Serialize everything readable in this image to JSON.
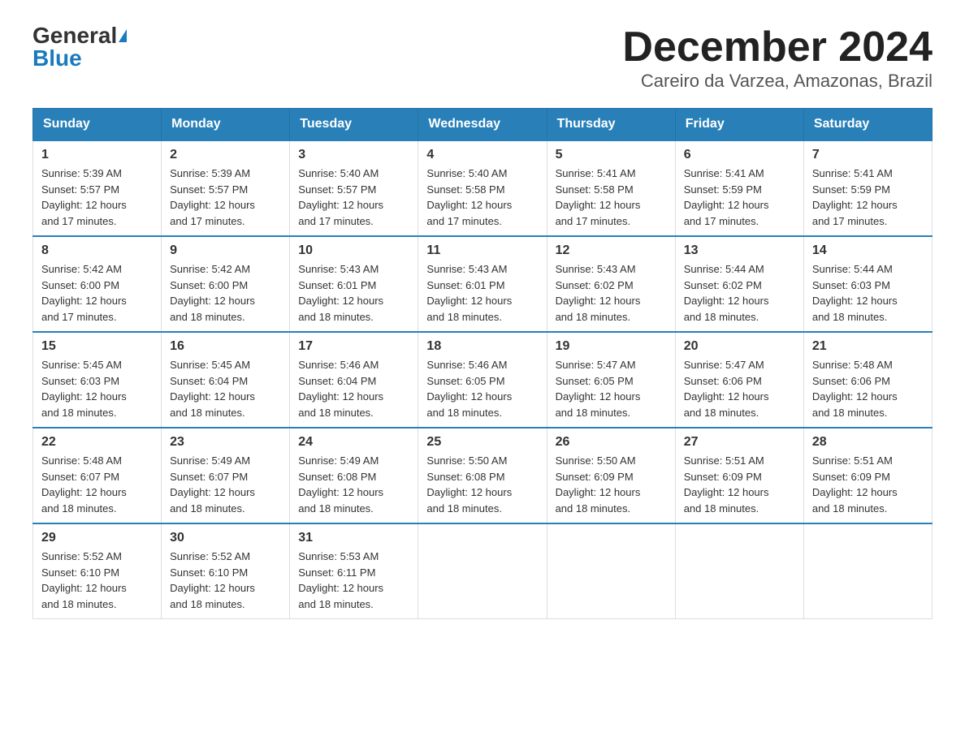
{
  "logo": {
    "general": "General",
    "blue": "Blue"
  },
  "title": "December 2024",
  "subtitle": "Careiro da Varzea, Amazonas, Brazil",
  "weekdays": [
    "Sunday",
    "Monday",
    "Tuesday",
    "Wednesday",
    "Thursday",
    "Friday",
    "Saturday"
  ],
  "weeks": [
    [
      {
        "day": "1",
        "sunrise": "5:39 AM",
        "sunset": "5:57 PM",
        "daylight": "12 hours and 17 minutes."
      },
      {
        "day": "2",
        "sunrise": "5:39 AM",
        "sunset": "5:57 PM",
        "daylight": "12 hours and 17 minutes."
      },
      {
        "day": "3",
        "sunrise": "5:40 AM",
        "sunset": "5:57 PM",
        "daylight": "12 hours and 17 minutes."
      },
      {
        "day": "4",
        "sunrise": "5:40 AM",
        "sunset": "5:58 PM",
        "daylight": "12 hours and 17 minutes."
      },
      {
        "day": "5",
        "sunrise": "5:41 AM",
        "sunset": "5:58 PM",
        "daylight": "12 hours and 17 minutes."
      },
      {
        "day": "6",
        "sunrise": "5:41 AM",
        "sunset": "5:59 PM",
        "daylight": "12 hours and 17 minutes."
      },
      {
        "day": "7",
        "sunrise": "5:41 AM",
        "sunset": "5:59 PM",
        "daylight": "12 hours and 17 minutes."
      }
    ],
    [
      {
        "day": "8",
        "sunrise": "5:42 AM",
        "sunset": "6:00 PM",
        "daylight": "12 hours and 17 minutes."
      },
      {
        "day": "9",
        "sunrise": "5:42 AM",
        "sunset": "6:00 PM",
        "daylight": "12 hours and 18 minutes."
      },
      {
        "day": "10",
        "sunrise": "5:43 AM",
        "sunset": "6:01 PM",
        "daylight": "12 hours and 18 minutes."
      },
      {
        "day": "11",
        "sunrise": "5:43 AM",
        "sunset": "6:01 PM",
        "daylight": "12 hours and 18 minutes."
      },
      {
        "day": "12",
        "sunrise": "5:43 AM",
        "sunset": "6:02 PM",
        "daylight": "12 hours and 18 minutes."
      },
      {
        "day": "13",
        "sunrise": "5:44 AM",
        "sunset": "6:02 PM",
        "daylight": "12 hours and 18 minutes."
      },
      {
        "day": "14",
        "sunrise": "5:44 AM",
        "sunset": "6:03 PM",
        "daylight": "12 hours and 18 minutes."
      }
    ],
    [
      {
        "day": "15",
        "sunrise": "5:45 AM",
        "sunset": "6:03 PM",
        "daylight": "12 hours and 18 minutes."
      },
      {
        "day": "16",
        "sunrise": "5:45 AM",
        "sunset": "6:04 PM",
        "daylight": "12 hours and 18 minutes."
      },
      {
        "day": "17",
        "sunrise": "5:46 AM",
        "sunset": "6:04 PM",
        "daylight": "12 hours and 18 minutes."
      },
      {
        "day": "18",
        "sunrise": "5:46 AM",
        "sunset": "6:05 PM",
        "daylight": "12 hours and 18 minutes."
      },
      {
        "day": "19",
        "sunrise": "5:47 AM",
        "sunset": "6:05 PM",
        "daylight": "12 hours and 18 minutes."
      },
      {
        "day": "20",
        "sunrise": "5:47 AM",
        "sunset": "6:06 PM",
        "daylight": "12 hours and 18 minutes."
      },
      {
        "day": "21",
        "sunrise": "5:48 AM",
        "sunset": "6:06 PM",
        "daylight": "12 hours and 18 minutes."
      }
    ],
    [
      {
        "day": "22",
        "sunrise": "5:48 AM",
        "sunset": "6:07 PM",
        "daylight": "12 hours and 18 minutes."
      },
      {
        "day": "23",
        "sunrise": "5:49 AM",
        "sunset": "6:07 PM",
        "daylight": "12 hours and 18 minutes."
      },
      {
        "day": "24",
        "sunrise": "5:49 AM",
        "sunset": "6:08 PM",
        "daylight": "12 hours and 18 minutes."
      },
      {
        "day": "25",
        "sunrise": "5:50 AM",
        "sunset": "6:08 PM",
        "daylight": "12 hours and 18 minutes."
      },
      {
        "day": "26",
        "sunrise": "5:50 AM",
        "sunset": "6:09 PM",
        "daylight": "12 hours and 18 minutes."
      },
      {
        "day": "27",
        "sunrise": "5:51 AM",
        "sunset": "6:09 PM",
        "daylight": "12 hours and 18 minutes."
      },
      {
        "day": "28",
        "sunrise": "5:51 AM",
        "sunset": "6:09 PM",
        "daylight": "12 hours and 18 minutes."
      }
    ],
    [
      {
        "day": "29",
        "sunrise": "5:52 AM",
        "sunset": "6:10 PM",
        "daylight": "12 hours and 18 minutes."
      },
      {
        "day": "30",
        "sunrise": "5:52 AM",
        "sunset": "6:10 PM",
        "daylight": "12 hours and 18 minutes."
      },
      {
        "day": "31",
        "sunrise": "5:53 AM",
        "sunset": "6:11 PM",
        "daylight": "12 hours and 18 minutes."
      },
      null,
      null,
      null,
      null
    ]
  ]
}
